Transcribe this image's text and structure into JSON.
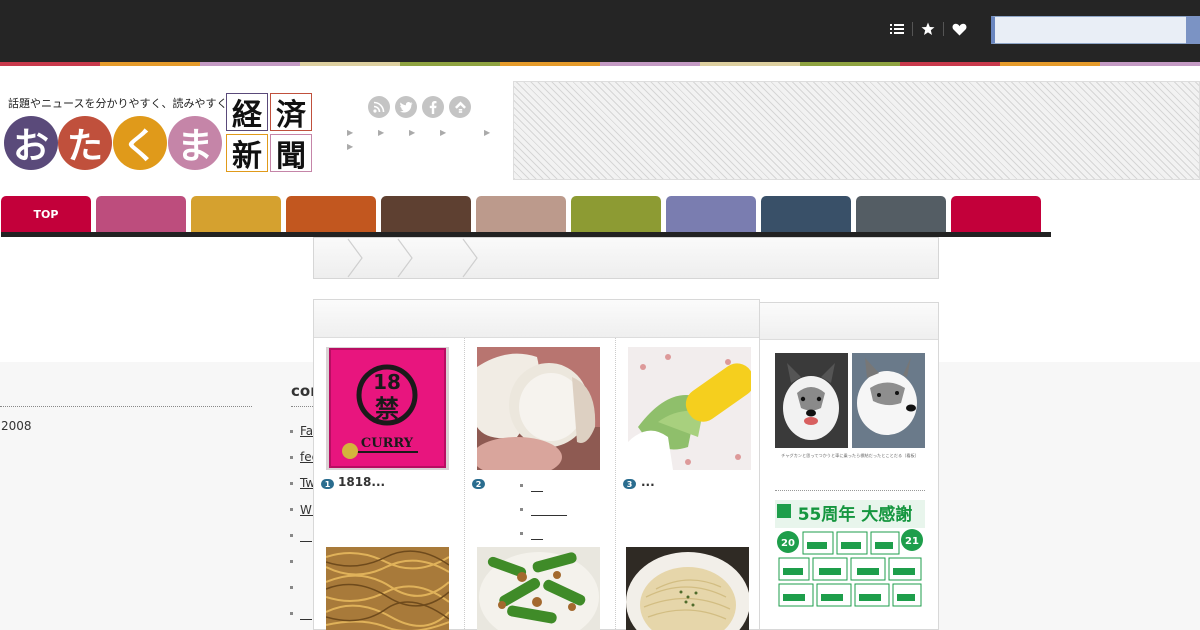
{
  "header": {
    "tagline": "話題やニュースを分かりやすく、読みやすく。",
    "logo_hiragana": [
      "お",
      "た",
      "く",
      "ま"
    ],
    "logo_kanji": [
      "経",
      "済",
      "新",
      "聞"
    ],
    "logo_colors": [
      "#5a4a7a",
      "#c0503c",
      "#e09a1a",
      "#c585a8"
    ],
    "social_icons": [
      "rss-icon",
      "twitter-icon",
      "facebook-icon",
      "feedly-icon"
    ]
  },
  "topbar": {
    "icons": [
      "list-icon",
      "star-icon",
      "heart-icon"
    ],
    "search_placeholder": ""
  },
  "colors": {
    "strip": [
      "#c9394c",
      "#e59b2a",
      "#c49ac4",
      "#ddd0a0",
      "#8fa340",
      "#e59b2a",
      "#c49ac4",
      "#ddd0a0",
      "#8fa340",
      "#c9394c",
      "#e59b2a",
      "#c49ac4"
    ],
    "nav": [
      "#c3003a",
      "#bd4d7d",
      "#d5a12f",
      "#c2571f",
      "#5e4031",
      "#bc9a8c",
      "#8d9b33",
      "#7a7db0",
      "#395068",
      "#545d64",
      "#c3003a"
    ]
  },
  "nav": {
    "tabs": [
      "TOP",
      "",
      "",
      "",
      "",
      "",
      "",
      "",
      "",
      "",
      ""
    ]
  },
  "sidebar_left": {
    "year": "2008"
  },
  "contents": {
    "title": "cont",
    "links": [
      "Face",
      "feed",
      "Twitter",
      "WEB＿",
      "＿",
      "",
      "",
      "＿"
    ]
  },
  "ranking": {
    "items": [
      {
        "rank": "1",
        "title": "1818..."
      },
      {
        "rank": "2",
        "title": ""
      },
      {
        "rank": "3",
        "title": "..."
      }
    ],
    "sub_links": [
      "＿",
      "＿＿＿",
      "＿"
    ]
  },
  "right_panel": {
    "ad1_caption": "チャグカンと思ってつかうと車に乗ったら標結だったとことだる（看板）",
    "ad2_headline": "55周年 大感謝",
    "ad2_badge1": "20",
    "ad2_badge2": "21"
  },
  "thumbs": {
    "curry_box_number": "18",
    "curry_box_kanji": "禁",
    "curry_box_label": "CURRY"
  }
}
